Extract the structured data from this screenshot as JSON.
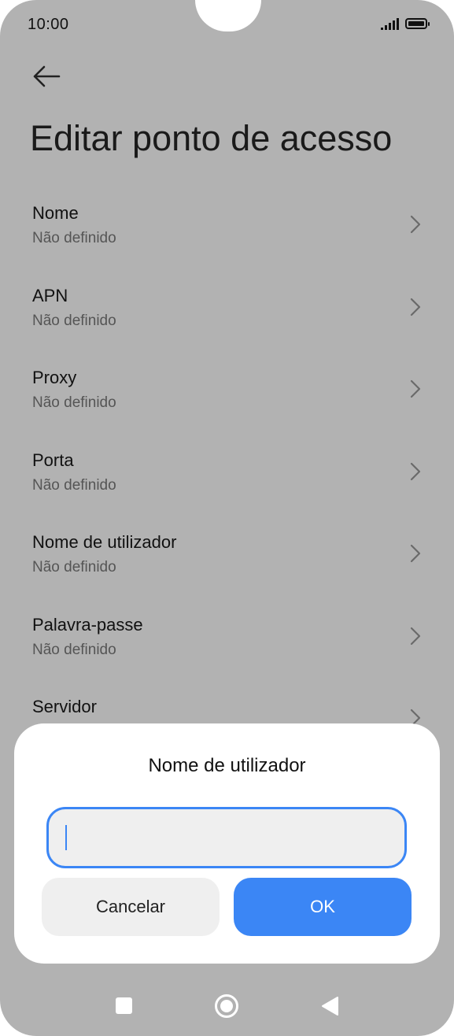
{
  "status_bar": {
    "time": "10:00"
  },
  "header": {
    "title": "Editar ponto de acesso"
  },
  "settings": {
    "items": [
      {
        "label": "Nome",
        "value": "Não definido"
      },
      {
        "label": "APN",
        "value": "Não definido"
      },
      {
        "label": "Proxy",
        "value": "Não definido"
      },
      {
        "label": "Porta",
        "value": "Não definido"
      },
      {
        "label": "Nome de utilizador",
        "value": "Não definido"
      },
      {
        "label": "Palavra-passe",
        "value": "Não definido"
      },
      {
        "label": "Servidor",
        "value": ""
      }
    ]
  },
  "dialog": {
    "title": "Nome de utilizador",
    "input_value": "",
    "cancel_label": "Cancelar",
    "ok_label": "OK"
  },
  "colors": {
    "accent": "#3b86f5",
    "overlay": "#b2b2b2"
  },
  "icons": {
    "back": "arrow-left-icon",
    "chevron": "chevron-right-icon",
    "nav_recents": "square-icon",
    "nav_home": "circle-icon",
    "nav_back": "triangle-back-icon"
  }
}
